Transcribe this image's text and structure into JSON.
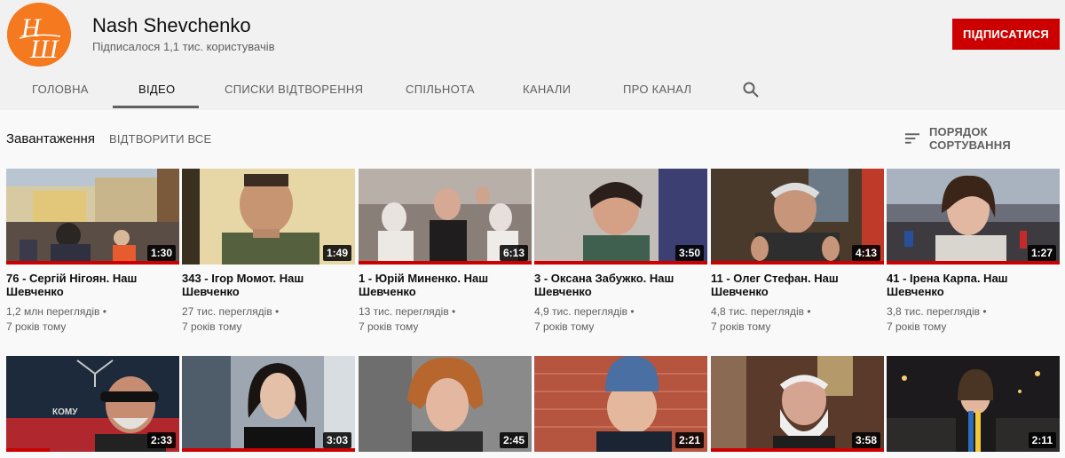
{
  "channel": {
    "name": "Nash Shevchenko",
    "subscribers": "Підписалося 1,1 тис. користувачів",
    "subscribe_label": "ПІДПИСАТИСЯ",
    "brand_color": "#f4791f",
    "subscribe_color": "#cc0000"
  },
  "tabs": [
    {
      "label": "ГОЛОВНА"
    },
    {
      "label": "ВІДЕО"
    },
    {
      "label": "СПИСКИ ВІДТВОРЕННЯ"
    },
    {
      "label": "СПІЛЬНОТА"
    },
    {
      "label": "КАНАЛИ"
    },
    {
      "label": "ПРО КАНАЛ"
    }
  ],
  "search_icon": "search-icon",
  "toolbar": {
    "section": "Завантаження",
    "play_all": "ВІДТВОРИТИ ВСЕ",
    "sort_label": "ПОРЯДОК СОРТУВАННЯ"
  },
  "videos_row1": [
    {
      "title": "76 - Сергій Нігоян. Наш Шевченко",
      "views": "1,2 млн переглядів •",
      "age": "7 років тому",
      "duration": "1:30",
      "watched": 1.0
    },
    {
      "title": "343 - Ігор Момот. Наш Шевченко",
      "views": "27 тис. переглядів •",
      "age": "7 років тому",
      "duration": "1:49",
      "watched": 0
    },
    {
      "title": "1 - Юрій Миненко. Наш Шевченко",
      "views": "13 тис. переглядів •",
      "age": "7 років тому",
      "duration": "6:13",
      "watched": 1.0
    },
    {
      "title": "3 - Оксана Забужко. Наш Шевченко",
      "views": "4,9 тис. переглядів •",
      "age": "7 років тому",
      "duration": "3:50",
      "watched": 1.0
    },
    {
      "title": "11 - Олег Стефан. Наш Шевченко",
      "views": "4,8 тис. переглядів •",
      "age": "7 років тому",
      "duration": "4:13",
      "watched": 1.0
    },
    {
      "title": "41 - Ірена Карпа. Наш Шевченко",
      "views": "3,8 тис. переглядів •",
      "age": "7 років тому",
      "duration": "1:27",
      "watched": 1.0
    }
  ],
  "videos_row2": [
    {
      "duration": "2:33",
      "watched": 0.25
    },
    {
      "duration": "3:03",
      "watched": 1.0
    },
    {
      "duration": "2:45",
      "watched": 0
    },
    {
      "duration": "2:21",
      "watched": 0
    },
    {
      "duration": "3:58",
      "watched": 1.0
    },
    {
      "duration": "2:11",
      "watched": 0
    }
  ]
}
